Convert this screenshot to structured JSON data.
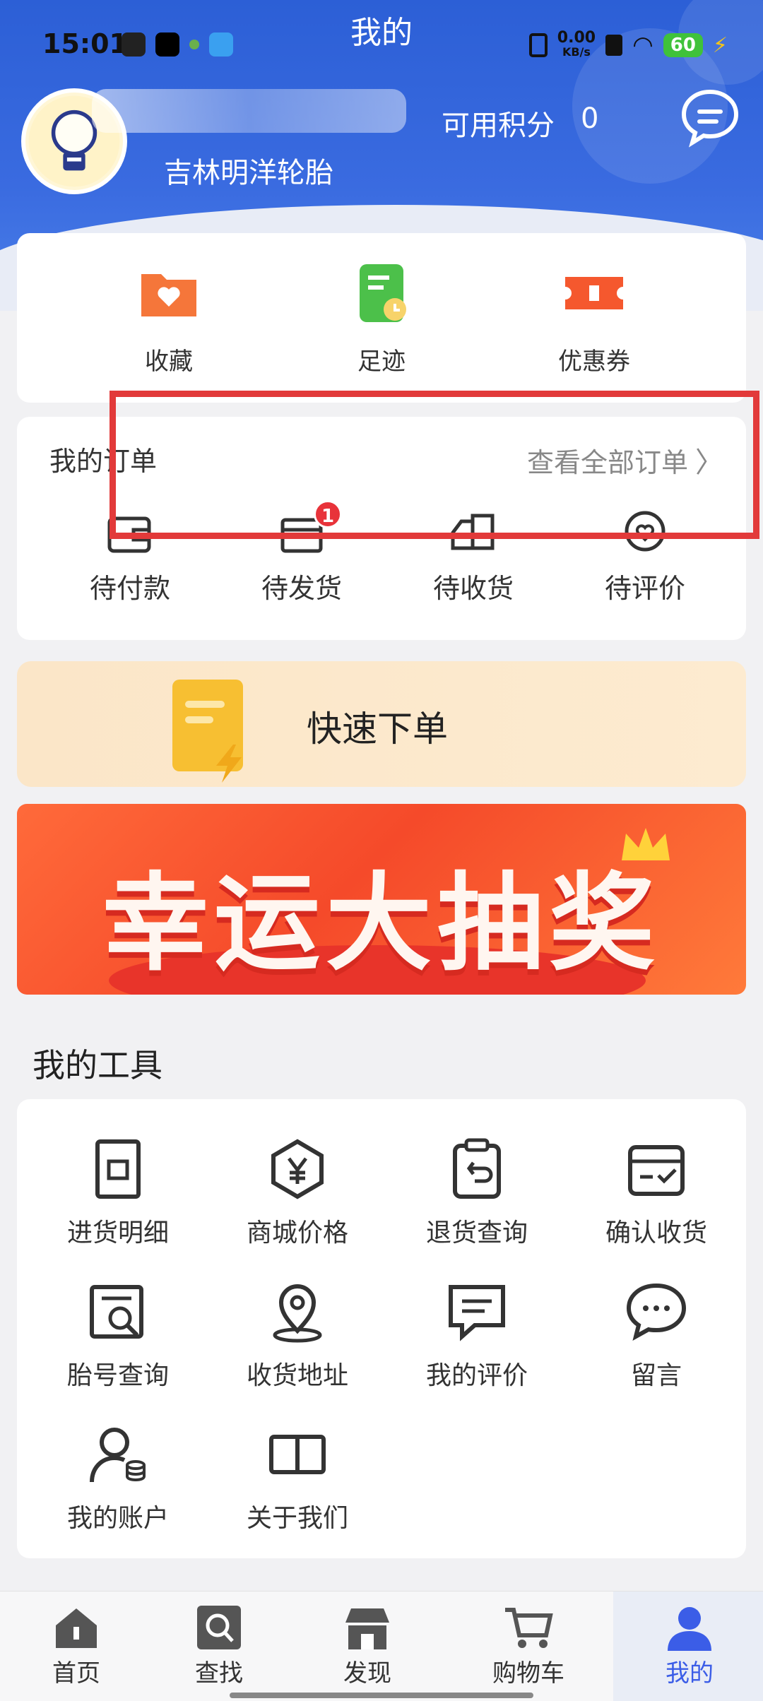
{
  "status_bar": {
    "time": "15:01",
    "net_speed_value": "0.00",
    "net_speed_unit": "KB/s",
    "battery": "60"
  },
  "header": {
    "title": "我的",
    "store_name": "吉林明洋轮胎",
    "points_label": "可用积分",
    "points_value": "0"
  },
  "shortcuts": [
    {
      "label": "收藏",
      "icon": "favorite-folder-icon"
    },
    {
      "label": "足迹",
      "icon": "footprint-icon"
    },
    {
      "label": "优惠券",
      "icon": "coupon-icon"
    }
  ],
  "orders": {
    "title": "我的订单",
    "view_all": "查看全部订单",
    "items": [
      {
        "label": "待付款",
        "icon": "wallet-icon"
      },
      {
        "label": "待发货",
        "icon": "box-icon",
        "badge": "1"
      },
      {
        "label": "待收货",
        "icon": "truck-icon"
      },
      {
        "label": "待评价",
        "icon": "review-heart-icon"
      }
    ]
  },
  "quick_order": {
    "label": "快速下单"
  },
  "banner": {
    "title": "幸运大抽奖"
  },
  "tools": {
    "title": "我的工具",
    "items": [
      {
        "label": "进货明细",
        "icon": "purchase-detail-icon"
      },
      {
        "label": "商城价格",
        "icon": "price-yen-icon"
      },
      {
        "label": "退货查询",
        "icon": "return-clipboard-icon"
      },
      {
        "label": "确认收货",
        "icon": "confirm-receipt-icon"
      },
      {
        "label": "胎号查询",
        "icon": "tire-search-icon"
      },
      {
        "label": "收货地址",
        "icon": "location-pin-icon"
      },
      {
        "label": "我的评价",
        "icon": "comment-icon"
      },
      {
        "label": "留言",
        "icon": "message-bubble-icon"
      },
      {
        "label": "我的账户",
        "icon": "account-user-icon"
      },
      {
        "label": "关于我们",
        "icon": "book-icon"
      }
    ]
  },
  "tabbar": {
    "items": [
      {
        "label": "首页",
        "icon": "home-icon"
      },
      {
        "label": "查找",
        "icon": "search-icon"
      },
      {
        "label": "发现",
        "icon": "store-icon"
      },
      {
        "label": "购物车",
        "icon": "cart-icon"
      },
      {
        "label": "我的",
        "icon": "user-icon",
        "active": true
      }
    ]
  },
  "colors": {
    "primary": "#3b5de7",
    "header": "#2c5fd6",
    "badge": "#e8333a",
    "highlight_box": "#e23a3a"
  }
}
